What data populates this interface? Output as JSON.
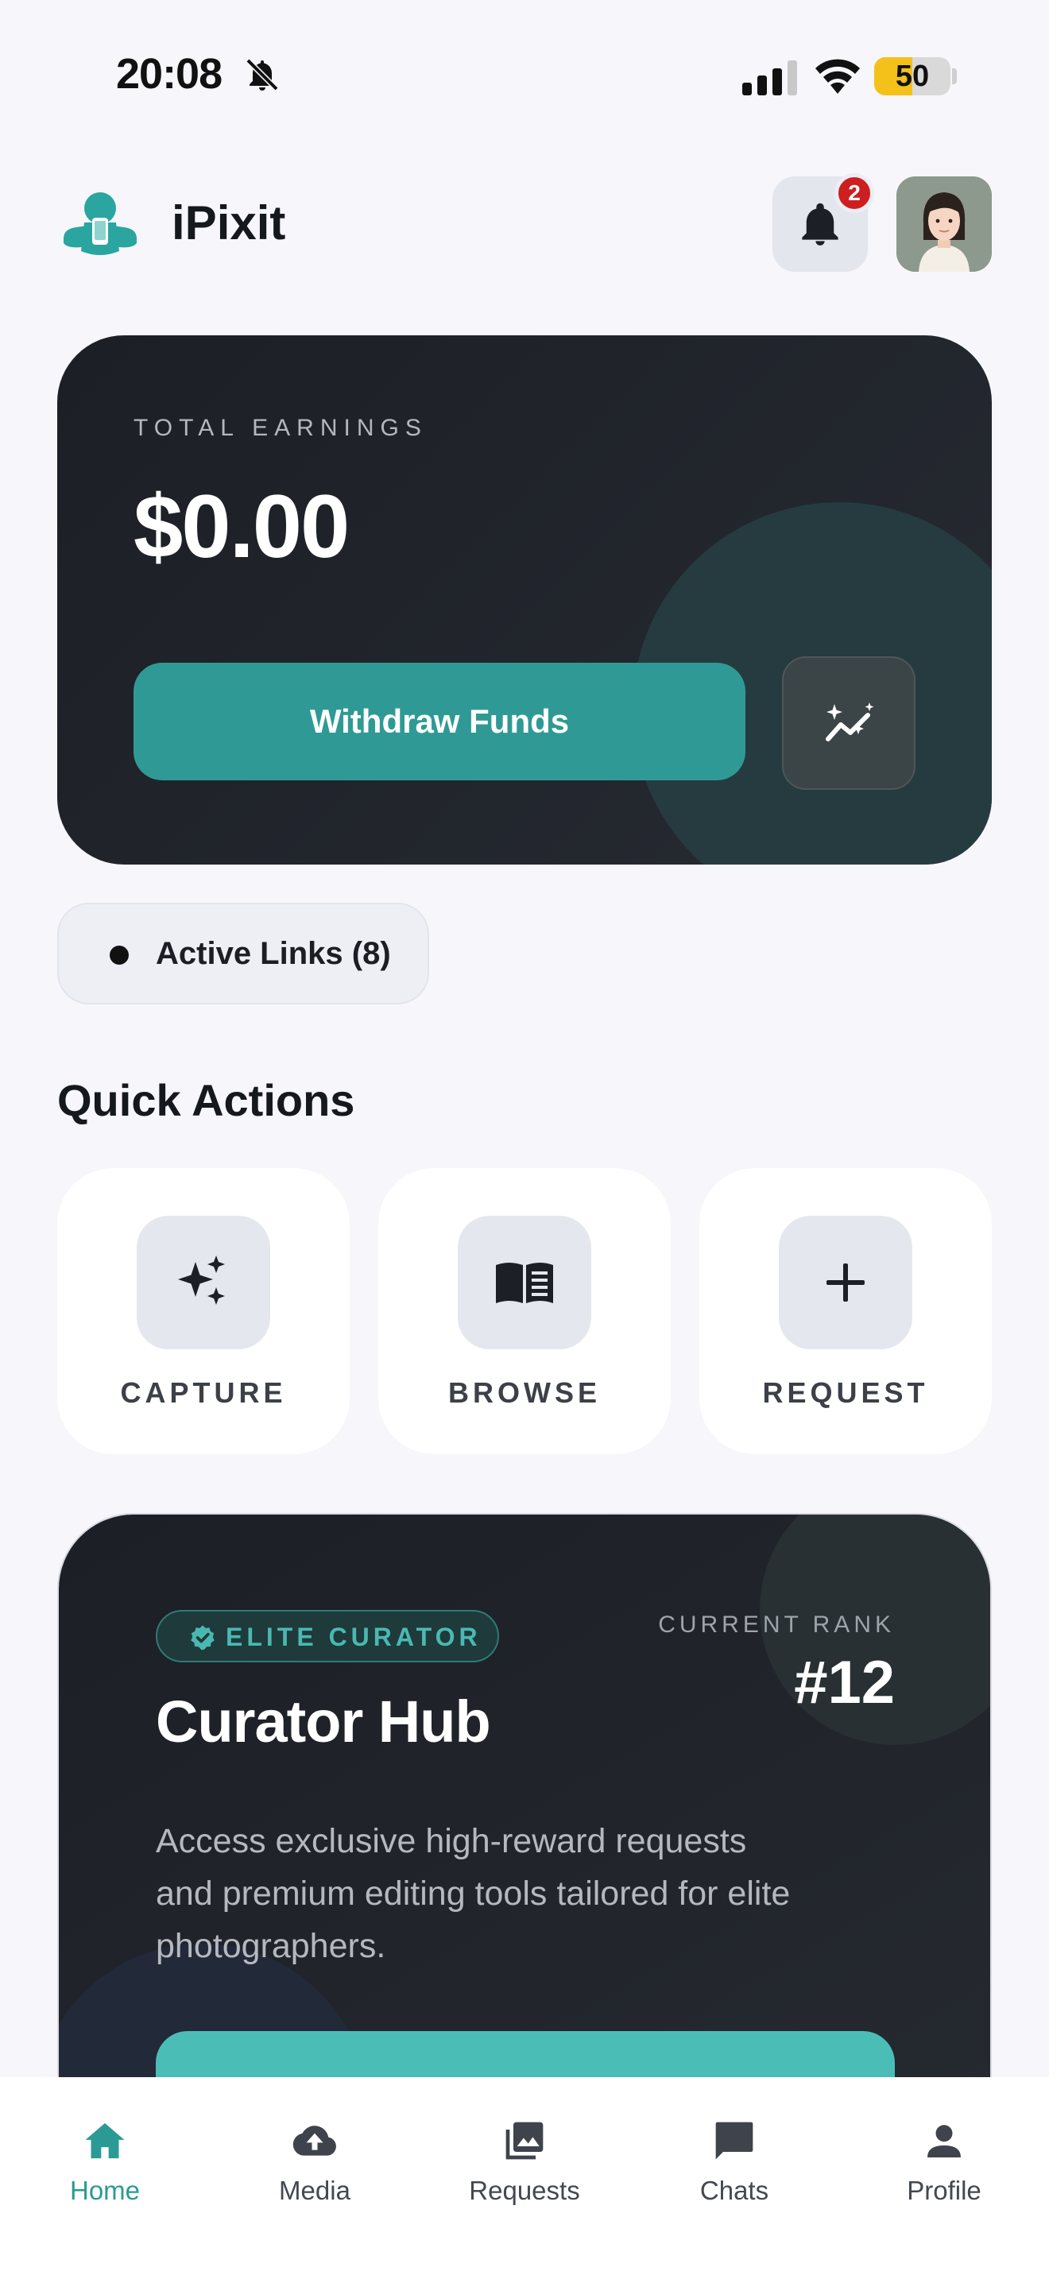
{
  "status_bar": {
    "time": "20:08",
    "battery": "50",
    "icons": [
      "bell-slash-icon",
      "signal-icon",
      "wifi-icon",
      "battery-icon"
    ]
  },
  "header": {
    "app_name": "iPixit",
    "notification_count": "2",
    "icons": [
      "logo-icon",
      "bell-icon",
      "avatar"
    ]
  },
  "earnings": {
    "label": "TOTAL EARNINGS",
    "amount": "$0.00",
    "withdraw_label": "Withdraw Funds",
    "trend_icon": "trend-sparkle-icon"
  },
  "active_links": {
    "label": "Active Links (8)"
  },
  "quick_actions": {
    "title": "Quick Actions",
    "items": [
      {
        "label": "CAPTURE",
        "icon": "sparkles-icon"
      },
      {
        "label": "BROWSE",
        "icon": "book-open-icon"
      },
      {
        "label": "REQUEST",
        "icon": "plus-icon"
      }
    ]
  },
  "curator_hub": {
    "badge": "ELITE CURATOR",
    "rank_label": "CURRENT RANK",
    "rank": "#12",
    "title": "Curator Hub",
    "description": "Access exclusive high-reward requests and premium editing tools tailored for elite photographers."
  },
  "bottom_nav": {
    "items": [
      {
        "label": "Home",
        "icon": "home-icon",
        "active": true
      },
      {
        "label": "Media",
        "icon": "cloud-upload-icon",
        "active": false
      },
      {
        "label": "Requests",
        "icon": "photo-library-icon",
        "active": false
      },
      {
        "label": "Chats",
        "icon": "chat-bubble-icon",
        "active": false
      },
      {
        "label": "Profile",
        "icon": "person-icon",
        "active": false
      }
    ]
  },
  "colors": {
    "accent": "#2f9a95",
    "accent_light": "#4bbdb7",
    "dark_card": "#1c1f25",
    "badge_red": "#cd1f1f",
    "battery_yellow": "#f4c11b"
  }
}
